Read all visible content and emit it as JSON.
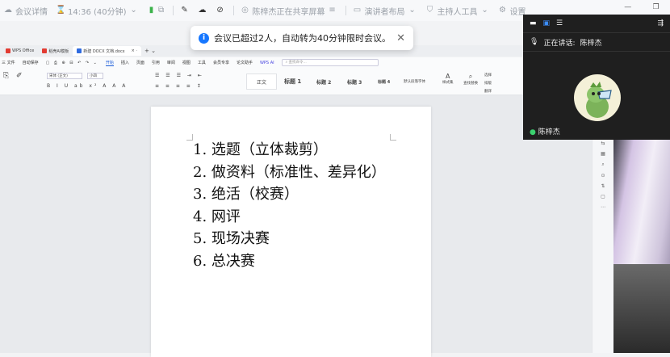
{
  "meeting_bar": {
    "app_name": "会议详情",
    "timer": "14:36 (40分钟)",
    "sharing_text": "陈梓杰正在共享屏幕",
    "layout_label": "演讲者布局",
    "host_tools_label": "主持人工具",
    "settings_label": "设置"
  },
  "notice": {
    "text": "会议已超过2人，自动转为40分钟限时会议。"
  },
  "tabs": [
    {
      "label": "WPS Office",
      "color": "#e23b32"
    },
    {
      "label": "稻壳AI模板",
      "color": "#e23b32"
    },
    {
      "label": "新建 DOCX 文档.docx",
      "color": "#2f6be0"
    }
  ],
  "menu": {
    "items": [
      "三 文件",
      "自动保存",
      "开始",
      "插入",
      "页面",
      "引用",
      "审阅",
      "视图",
      "工具",
      "会员专享",
      "论文助手",
      "WPS AI"
    ],
    "active": "开始",
    "search_placeholder": "查找命令..."
  },
  "ribbon": {
    "font_name": "宋体 (正文)",
    "font_size": "小四",
    "styles": [
      "正文",
      "标题 1",
      "标题 2",
      "标题 3",
      "标题 4",
      "默认段落字体"
    ],
    "right_tools": [
      "样式集",
      "查找替换",
      "选择",
      "排版",
      "翻译"
    ]
  },
  "document": {
    "lines": [
      "1. 选题（立体裁剪）",
      "2. 做资料（标准性、差异化）",
      "3. 绝活（校赛）",
      "4. 网评",
      "5. 现场决赛",
      "6. 总决赛"
    ]
  },
  "speaker_panel": {
    "speaking_prefix": "正在讲话:",
    "speaker_name": "陈梓杰",
    "bottom_name": "陈梓杰"
  }
}
